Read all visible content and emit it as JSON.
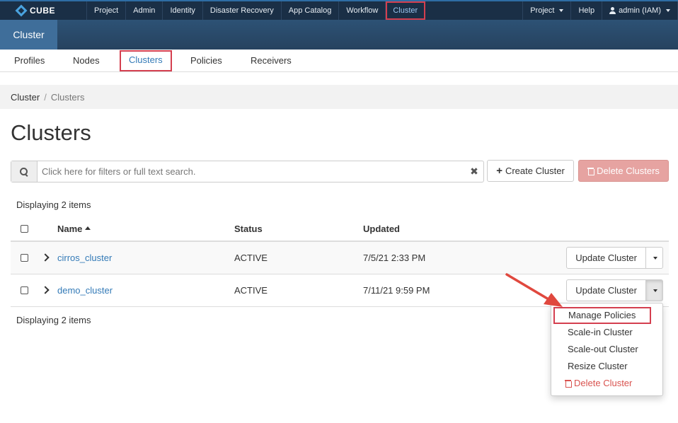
{
  "brand": {
    "logo_text": "CUBE"
  },
  "topnav": {
    "items": [
      {
        "label": "Project"
      },
      {
        "label": "Admin"
      },
      {
        "label": "Identity"
      },
      {
        "label": "Disaster Recovery"
      },
      {
        "label": "App Catalog"
      },
      {
        "label": "Workflow"
      },
      {
        "label": "Cluster"
      }
    ],
    "right": {
      "project_label": "Project",
      "help_label": "Help",
      "user_label": "admin (IAM)"
    }
  },
  "dashboard": {
    "active_tab": "Cluster"
  },
  "tabs": {
    "items": [
      {
        "label": "Profiles"
      },
      {
        "label": "Nodes"
      },
      {
        "label": "Clusters"
      },
      {
        "label": "Policies"
      },
      {
        "label": "Receivers"
      }
    ],
    "active": "Clusters"
  },
  "breadcrumb": {
    "parent": "Cluster",
    "separator": "/",
    "current": "Clusters"
  },
  "page": {
    "title": "Clusters"
  },
  "search": {
    "placeholder": "Click here for filters or full text search.",
    "value": ""
  },
  "actions": {
    "create_label": "Create Cluster",
    "delete_label": "Delete Clusters"
  },
  "table": {
    "count_top": "Displaying 2 items",
    "count_bottom": "Displaying 2 items",
    "columns": {
      "name": "Name",
      "status": "Status",
      "updated": "Updated"
    },
    "rows": [
      {
        "name": "cirros_cluster",
        "status": "ACTIVE",
        "updated": "7/5/21 2:33 PM",
        "action": "Update Cluster"
      },
      {
        "name": "demo_cluster",
        "status": "ACTIVE",
        "updated": "7/11/21 9:59 PM",
        "action": "Update Cluster"
      }
    ]
  },
  "row_menu": {
    "items": [
      {
        "label": "Manage Policies"
      },
      {
        "label": "Scale-in Cluster"
      },
      {
        "label": "Scale-out Cluster"
      },
      {
        "label": "Resize Cluster"
      },
      {
        "label": "Delete Cluster"
      }
    ]
  },
  "colors": {
    "navbar": "#1a2f46",
    "dashbar": "#2a4a6b",
    "link": "#337ab7",
    "highlight": "#d43f4f",
    "danger": "#d9534f"
  }
}
